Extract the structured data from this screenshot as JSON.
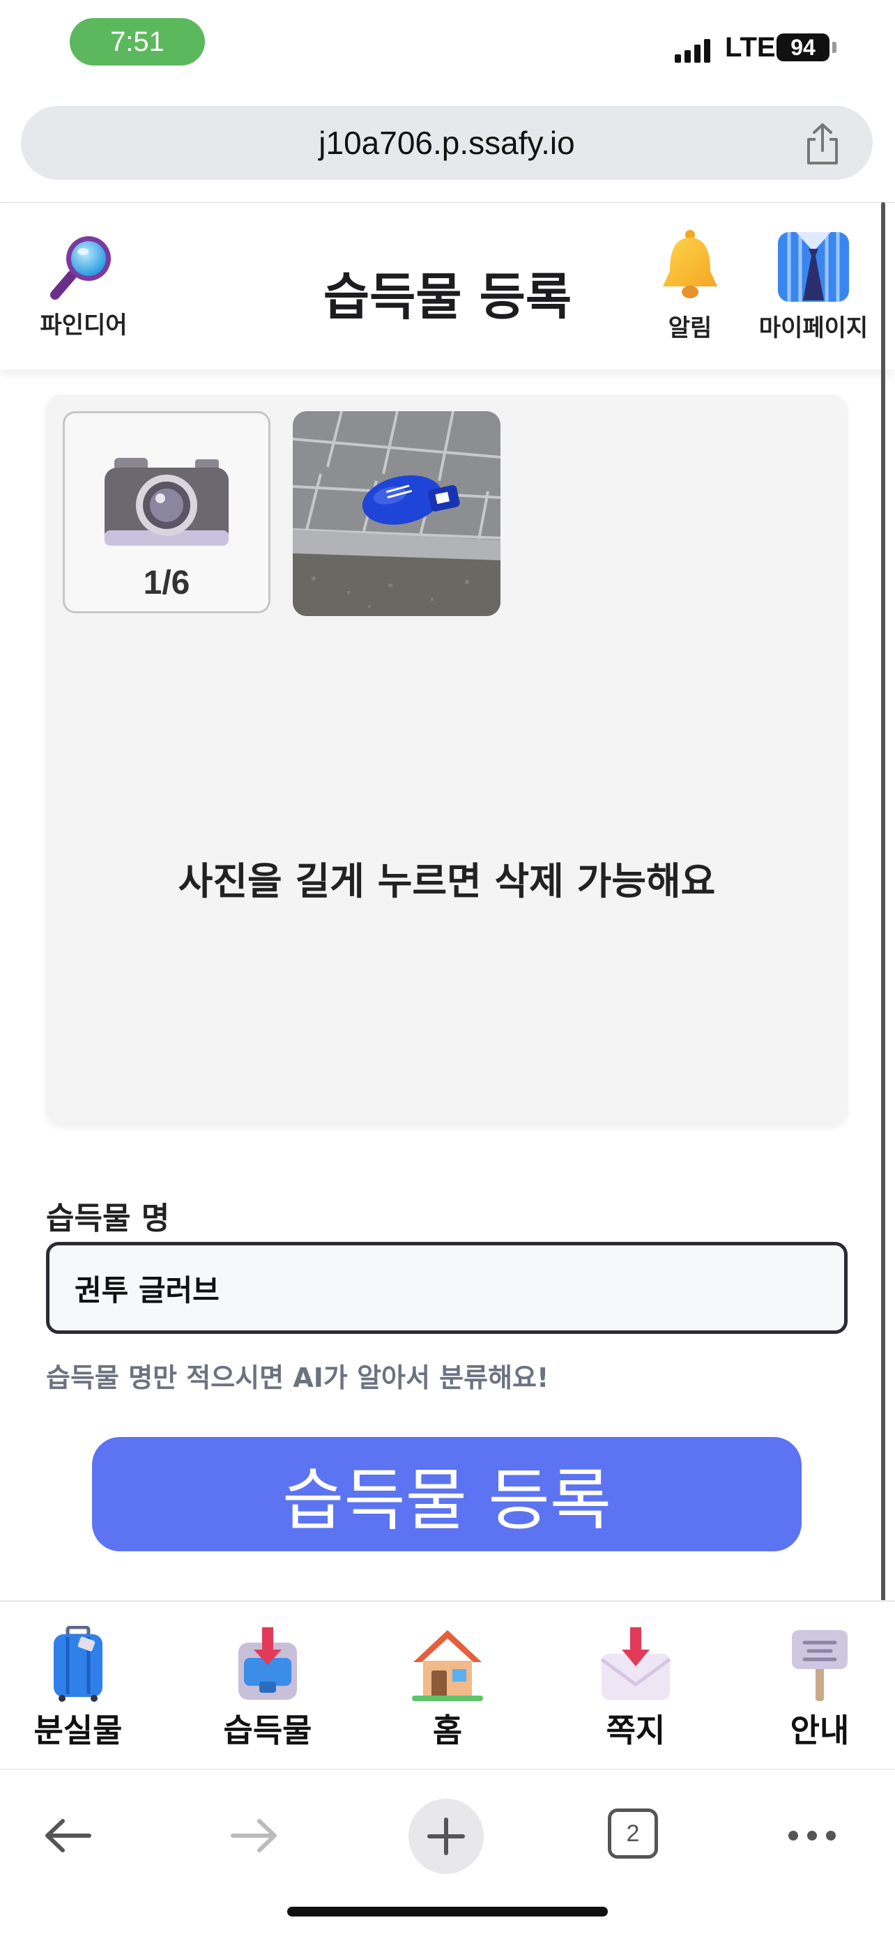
{
  "status_bar": {
    "time": "7:51",
    "network": "LTE",
    "battery": "94"
  },
  "browser": {
    "url": "j10a706.p.ssafy.io",
    "tab_count": "2"
  },
  "header": {
    "title": "습득물 등록",
    "finder_label": "파인디어",
    "alarm_label": "알림",
    "mypage_label": "마이페이지"
  },
  "photos": {
    "counter": "1/6",
    "hint": "사진을 길게 누르면 삭제 가능해요"
  },
  "form": {
    "name_label": "습득물 명",
    "name_value": "권투 글러브",
    "helper": "습득물 명만 적으시면 AI가 알아서 분류해요!",
    "submit_label": "습득물 등록"
  },
  "bottom_nav": {
    "items": [
      {
        "label": "분실물",
        "icon": "luggage-icon"
      },
      {
        "label": "습득물",
        "icon": "inbox-tray-icon"
      },
      {
        "label": "홈",
        "icon": "house-icon"
      },
      {
        "label": "쪽지",
        "icon": "envelope-icon"
      },
      {
        "label": "안내",
        "icon": "signboard-icon"
      }
    ]
  },
  "colors": {
    "primary": "#5c73f2",
    "time_pill": "#5cb85c"
  }
}
